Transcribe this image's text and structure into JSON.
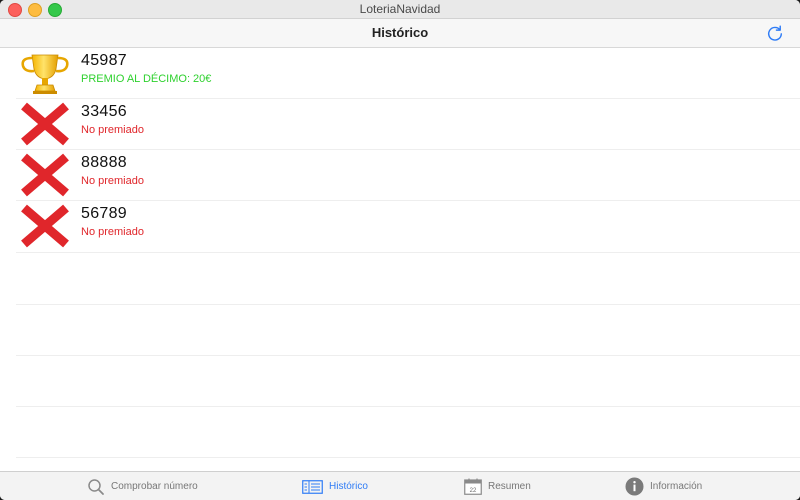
{
  "window": {
    "title": "LoteriaNavidad"
  },
  "navbar": {
    "title": "Histórico",
    "refresh_icon": "refresh-icon"
  },
  "colors": {
    "won": "#2fd12f",
    "lost": "#e0262b",
    "accent": "#2f7cf6"
  },
  "history": [
    {
      "number": "45987",
      "status": "PREMIO AL DÉCIMO: 20€",
      "result": "won",
      "icon": "trophy-icon"
    },
    {
      "number": "33456",
      "status": "No premiado",
      "result": "lost",
      "icon": "cross-icon"
    },
    {
      "number": "88888",
      "status": "No premiado",
      "result": "lost",
      "icon": "cross-icon"
    },
    {
      "number": "56789",
      "status": "No premiado",
      "result": "lost",
      "icon": "cross-icon"
    }
  ],
  "tabs": [
    {
      "label": "Comprobar número",
      "icon": "magnifier-icon",
      "active": false
    },
    {
      "label": "Histórico",
      "icon": "list-icon",
      "active": true
    },
    {
      "label": "Resumen",
      "icon": "calendar-icon",
      "active": false,
      "calendar_day": "22"
    },
    {
      "label": "Información",
      "icon": "info-icon",
      "active": false
    }
  ]
}
